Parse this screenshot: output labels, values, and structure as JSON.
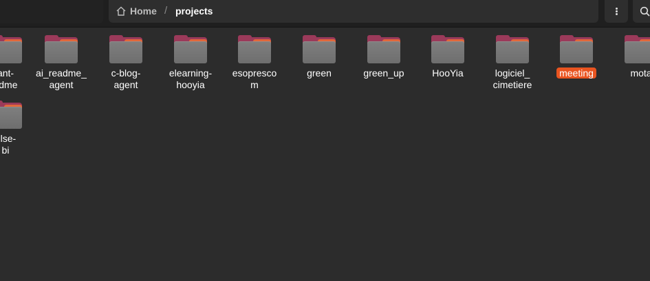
{
  "breadcrumb": {
    "home_label": "Home",
    "separator": "/",
    "current_label": "projects"
  },
  "folders": [
    {
      "label": "ant-\nadme",
      "selected": false
    },
    {
      "label": "ai_readme_\nagent",
      "selected": false
    },
    {
      "label": "c-blog-\nagent",
      "selected": false
    },
    {
      "label": "elearning-\nhooyia",
      "selected": false
    },
    {
      "label": "esopresco\nm",
      "selected": false
    },
    {
      "label": "green",
      "selected": false
    },
    {
      "label": "green_up",
      "selected": false
    },
    {
      "label": "HooYia",
      "selected": false
    },
    {
      "label": "logiciel_\ncimetiere",
      "selected": false
    },
    {
      "label": "meeting",
      "selected": true
    },
    {
      "label": "mota",
      "selected": false
    },
    {
      "label": "ulse-\nbi",
      "selected": false
    }
  ],
  "colors": {
    "accent": "#e95420",
    "background": "#2c2c2c"
  },
  "icons": {
    "home": "home-icon",
    "menu": "kebab-menu-icon",
    "search": "search-icon",
    "folder": "folder-icon"
  }
}
